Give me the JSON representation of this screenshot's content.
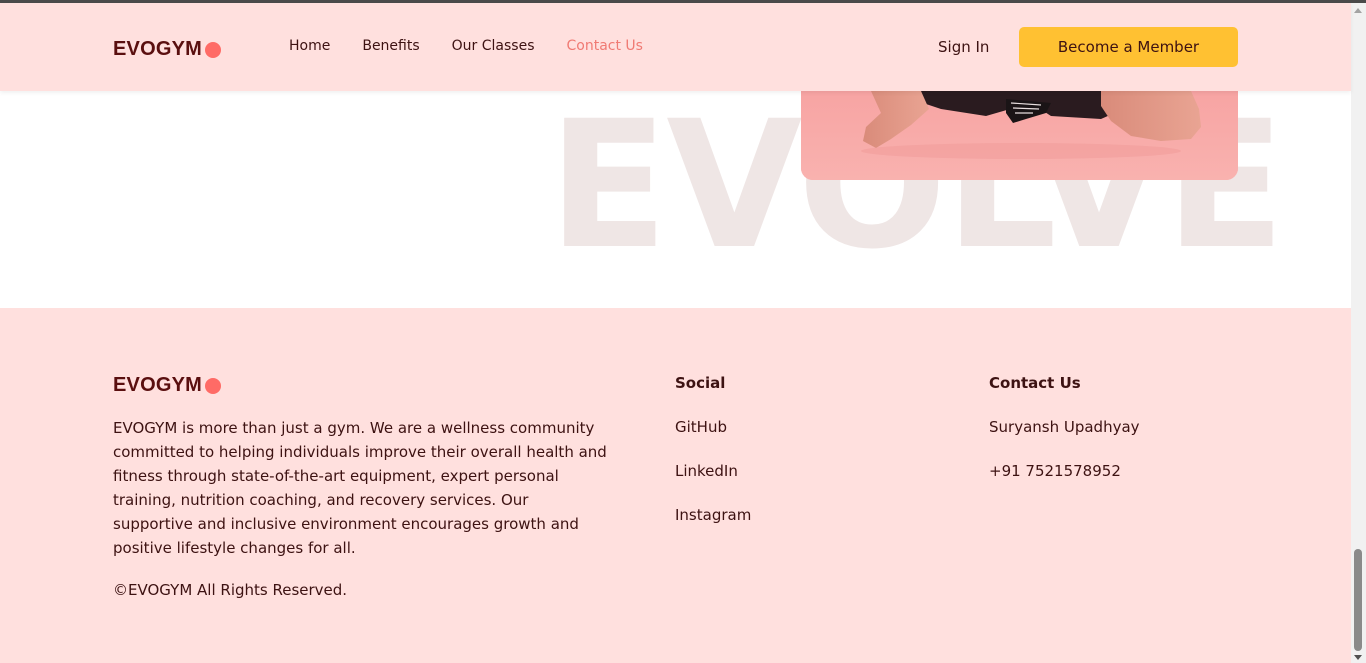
{
  "brand": {
    "name": "EVOGYM",
    "accent": "#ff6b66",
    "dark": "#5a0f0f",
    "bg_pink": "#ffe0de",
    "cta_yellow": "#ffc132"
  },
  "nav": {
    "links": [
      {
        "label": "Home",
        "active": false
      },
      {
        "label": "Benefits",
        "active": false
      },
      {
        "label": "Our Classes",
        "active": false
      },
      {
        "label": "Contact Us",
        "active": true
      }
    ],
    "sign_in": "Sign In",
    "cta": "Become a Member"
  },
  "hero": {
    "background_text": "EVOLVE"
  },
  "footer": {
    "about": "EVOGYM is more than just a gym. We are a wellness community committed to helping individuals improve their overall health and fitness through state-of-the-art equipment, expert personal training, nutrition coaching, and recovery services. Our supportive and inclusive environment encourages growth and positive lifestyle changes for all.",
    "copyright": "©EVOGYM All Rights Reserved.",
    "social": {
      "title": "Social",
      "links": [
        "GitHub",
        "LinkedIn",
        "Instagram"
      ]
    },
    "contact": {
      "title": "Contact Us",
      "name": "Suryansh Upadhyay",
      "phone": "+91 7521578952"
    }
  }
}
